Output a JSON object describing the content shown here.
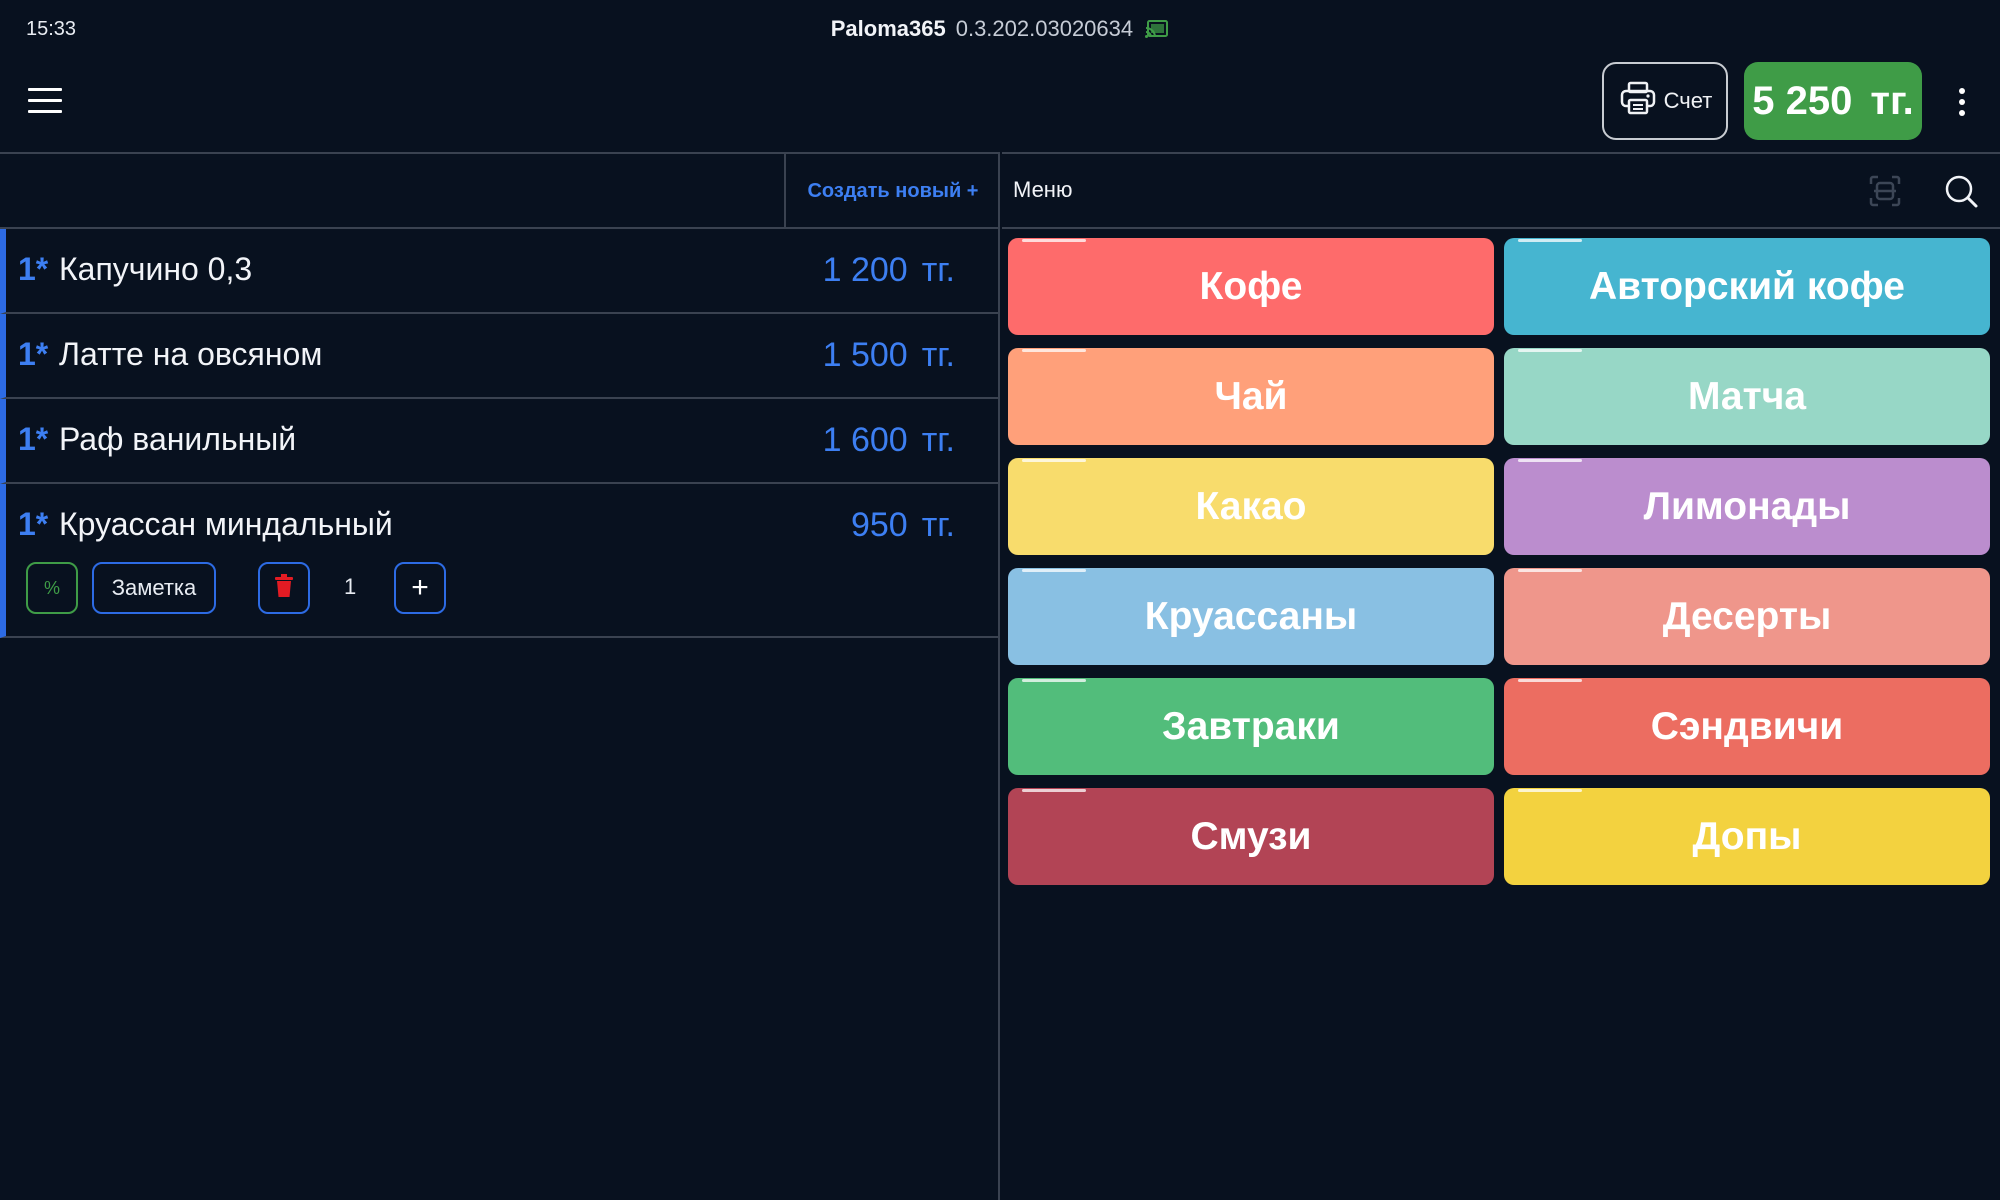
{
  "status_bar": {
    "time": "15:33",
    "app_name": "Paloma365",
    "app_version": "0.3.202.03020634",
    "cast_icon": "cast-connected-icon",
    "cast_color": "#3f9c47"
  },
  "toolbar": {
    "menu_icon": "hamburger-menu-icon",
    "bill_label": "Счет",
    "bill_icon": "printer-icon",
    "total_amount": "5 250",
    "total_currency": "тг.",
    "total_color": "#3f9c47",
    "more_icon": "more-vertical-icon"
  },
  "order": {
    "create_new_label": "Создать новый +",
    "accent_color": "#3d7ff2",
    "items": [
      {
        "qty": "1*",
        "name": "Капучино 0,3",
        "price": "1 200",
        "currency": "тг."
      },
      {
        "qty": "1*",
        "name": "Латте на овсяном",
        "price": "1 500",
        "currency": "тг."
      },
      {
        "qty": "1*",
        "name": "Раф ванильный",
        "price": "1 600",
        "currency": "тг."
      },
      {
        "qty": "1*",
        "name": "Круассан миндальный",
        "price": "950",
        "currency": "тг."
      }
    ],
    "selected_controls": {
      "discount_label": "%",
      "note_label": "Заметка",
      "delete_icon": "trash-icon",
      "quantity": "1",
      "plus_label": "+"
    }
  },
  "menu": {
    "title": "Меню",
    "scan_icon": "barcode-scan-icon",
    "search_icon": "search-icon",
    "categories": [
      {
        "label": "Кофе",
        "color": "#fe6b6b"
      },
      {
        "label": "Авторский кофе",
        "color": "#46b5d0"
      },
      {
        "label": "Чай",
        "color": "#ffa07a"
      },
      {
        "label": "Матча",
        "color": "#97d7c6"
      },
      {
        "label": "Какао",
        "color": "#f8dc6c"
      },
      {
        "label": "Лимонады",
        "color": "#bb8dce"
      },
      {
        "label": "Круассаны",
        "color": "#89c0e3"
      },
      {
        "label": "Десерты",
        "color": "#ef968b"
      },
      {
        "label": "Завтраки",
        "color": "#52bd7b"
      },
      {
        "label": "Сэндвичи",
        "color": "#ec6d61"
      },
      {
        "label": "Смузи",
        "color": "#b24455"
      },
      {
        "label": "Допы",
        "color": "#f3d23f"
      }
    ]
  }
}
